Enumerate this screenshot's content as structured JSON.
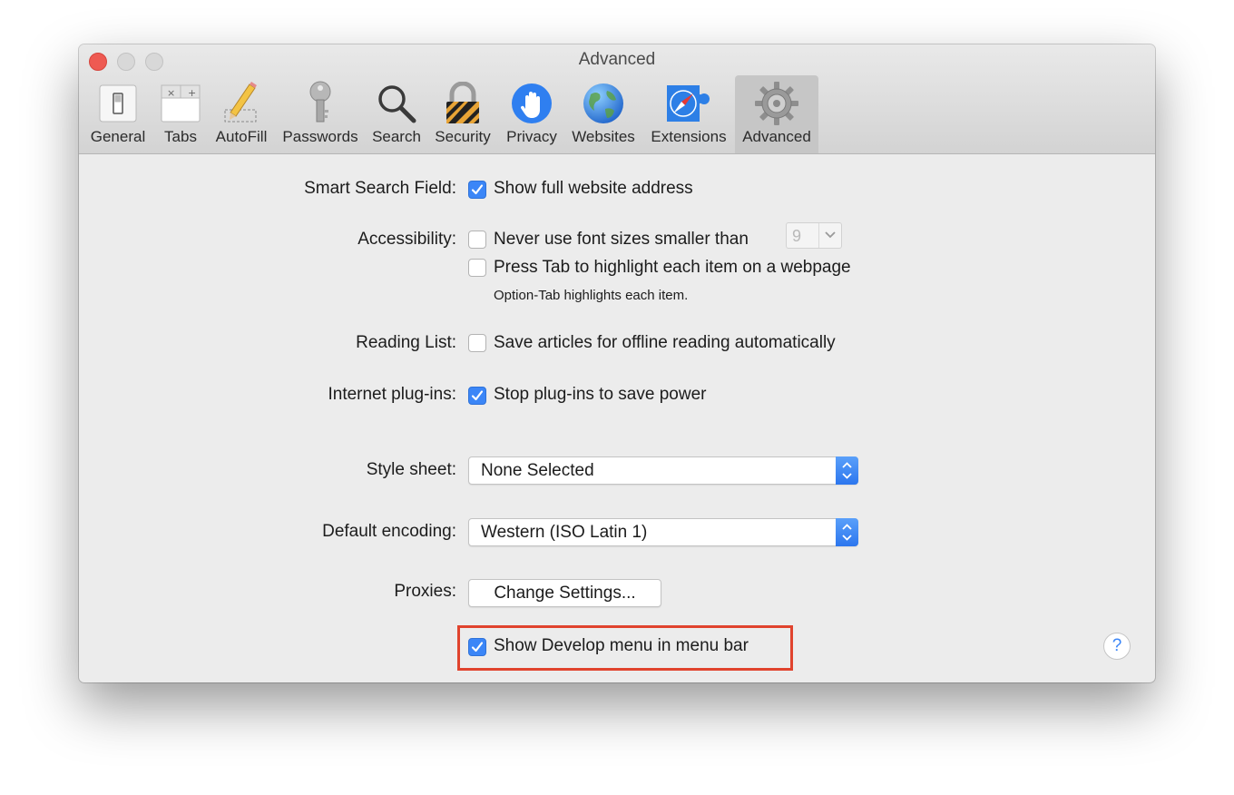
{
  "window": {
    "title": "Advanced"
  },
  "toolbar": {
    "items": [
      {
        "label": "General",
        "icon": "general-switch-icon"
      },
      {
        "label": "Tabs",
        "icon": "tabs-icon"
      },
      {
        "label": "AutoFill",
        "icon": "pencil-icon"
      },
      {
        "label": "Passwords",
        "icon": "key-icon"
      },
      {
        "label": "Search",
        "icon": "magnifier-icon"
      },
      {
        "label": "Security",
        "icon": "padlock-icon"
      },
      {
        "label": "Privacy",
        "icon": "hand-icon"
      },
      {
        "label": "Websites",
        "icon": "globe-icon"
      },
      {
        "label": "Extensions",
        "icon": "compass-puzzle-icon"
      },
      {
        "label": "Advanced",
        "icon": "gear-icon"
      }
    ],
    "selected": "Advanced"
  },
  "settings": {
    "smart_search": {
      "label": "Smart Search Field:",
      "option": "Show full website address",
      "checked": true
    },
    "accessibility": {
      "label": "Accessibility:",
      "font_option": "Never use font sizes smaller than",
      "font_checked": false,
      "font_size": "9",
      "tab_option": "Press Tab to highlight each item on a webpage",
      "tab_checked": false,
      "hint": "Option-Tab highlights each item."
    },
    "reading_list": {
      "label": "Reading List:",
      "option": "Save articles for offline reading automatically",
      "checked": false
    },
    "plugins": {
      "label": "Internet plug-ins:",
      "option": "Stop plug-ins to save power",
      "checked": true
    },
    "style_sheet": {
      "label": "Style sheet:",
      "value": "None Selected"
    },
    "encoding": {
      "label": "Default encoding:",
      "value": "Western (ISO Latin 1)"
    },
    "proxies": {
      "label": "Proxies:",
      "button": "Change Settings..."
    },
    "develop": {
      "option": "Show Develop menu in menu bar",
      "checked": true
    }
  },
  "help": {
    "symbol": "?"
  },
  "colors": {
    "accent": "#3b86f7",
    "annotation": "#e0432d"
  }
}
